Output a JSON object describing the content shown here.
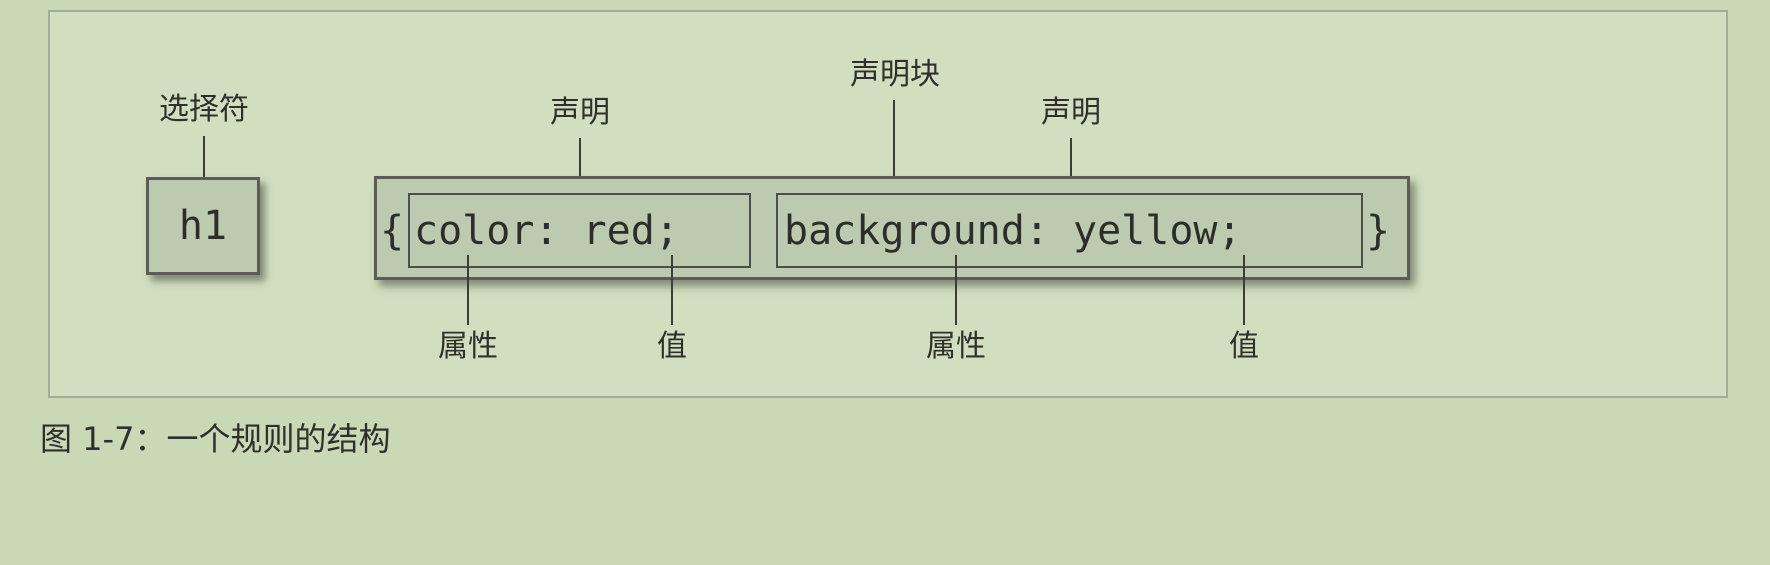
{
  "diagram": {
    "selector_label": "选择符",
    "declaration_block_label": "声明块",
    "declaration_label_1": "声明",
    "declaration_label_2": "声明",
    "property_label_1": "属性",
    "value_label_1": "值",
    "property_label_2": "属性",
    "value_label_2": "值",
    "selector_code": "h1",
    "open_brace": "{",
    "declaration_1_code": "color: red;",
    "declaration_2_code": "background: yellow;",
    "close_brace": "}"
  },
  "caption": "图 1-7：一个规则的结构"
}
